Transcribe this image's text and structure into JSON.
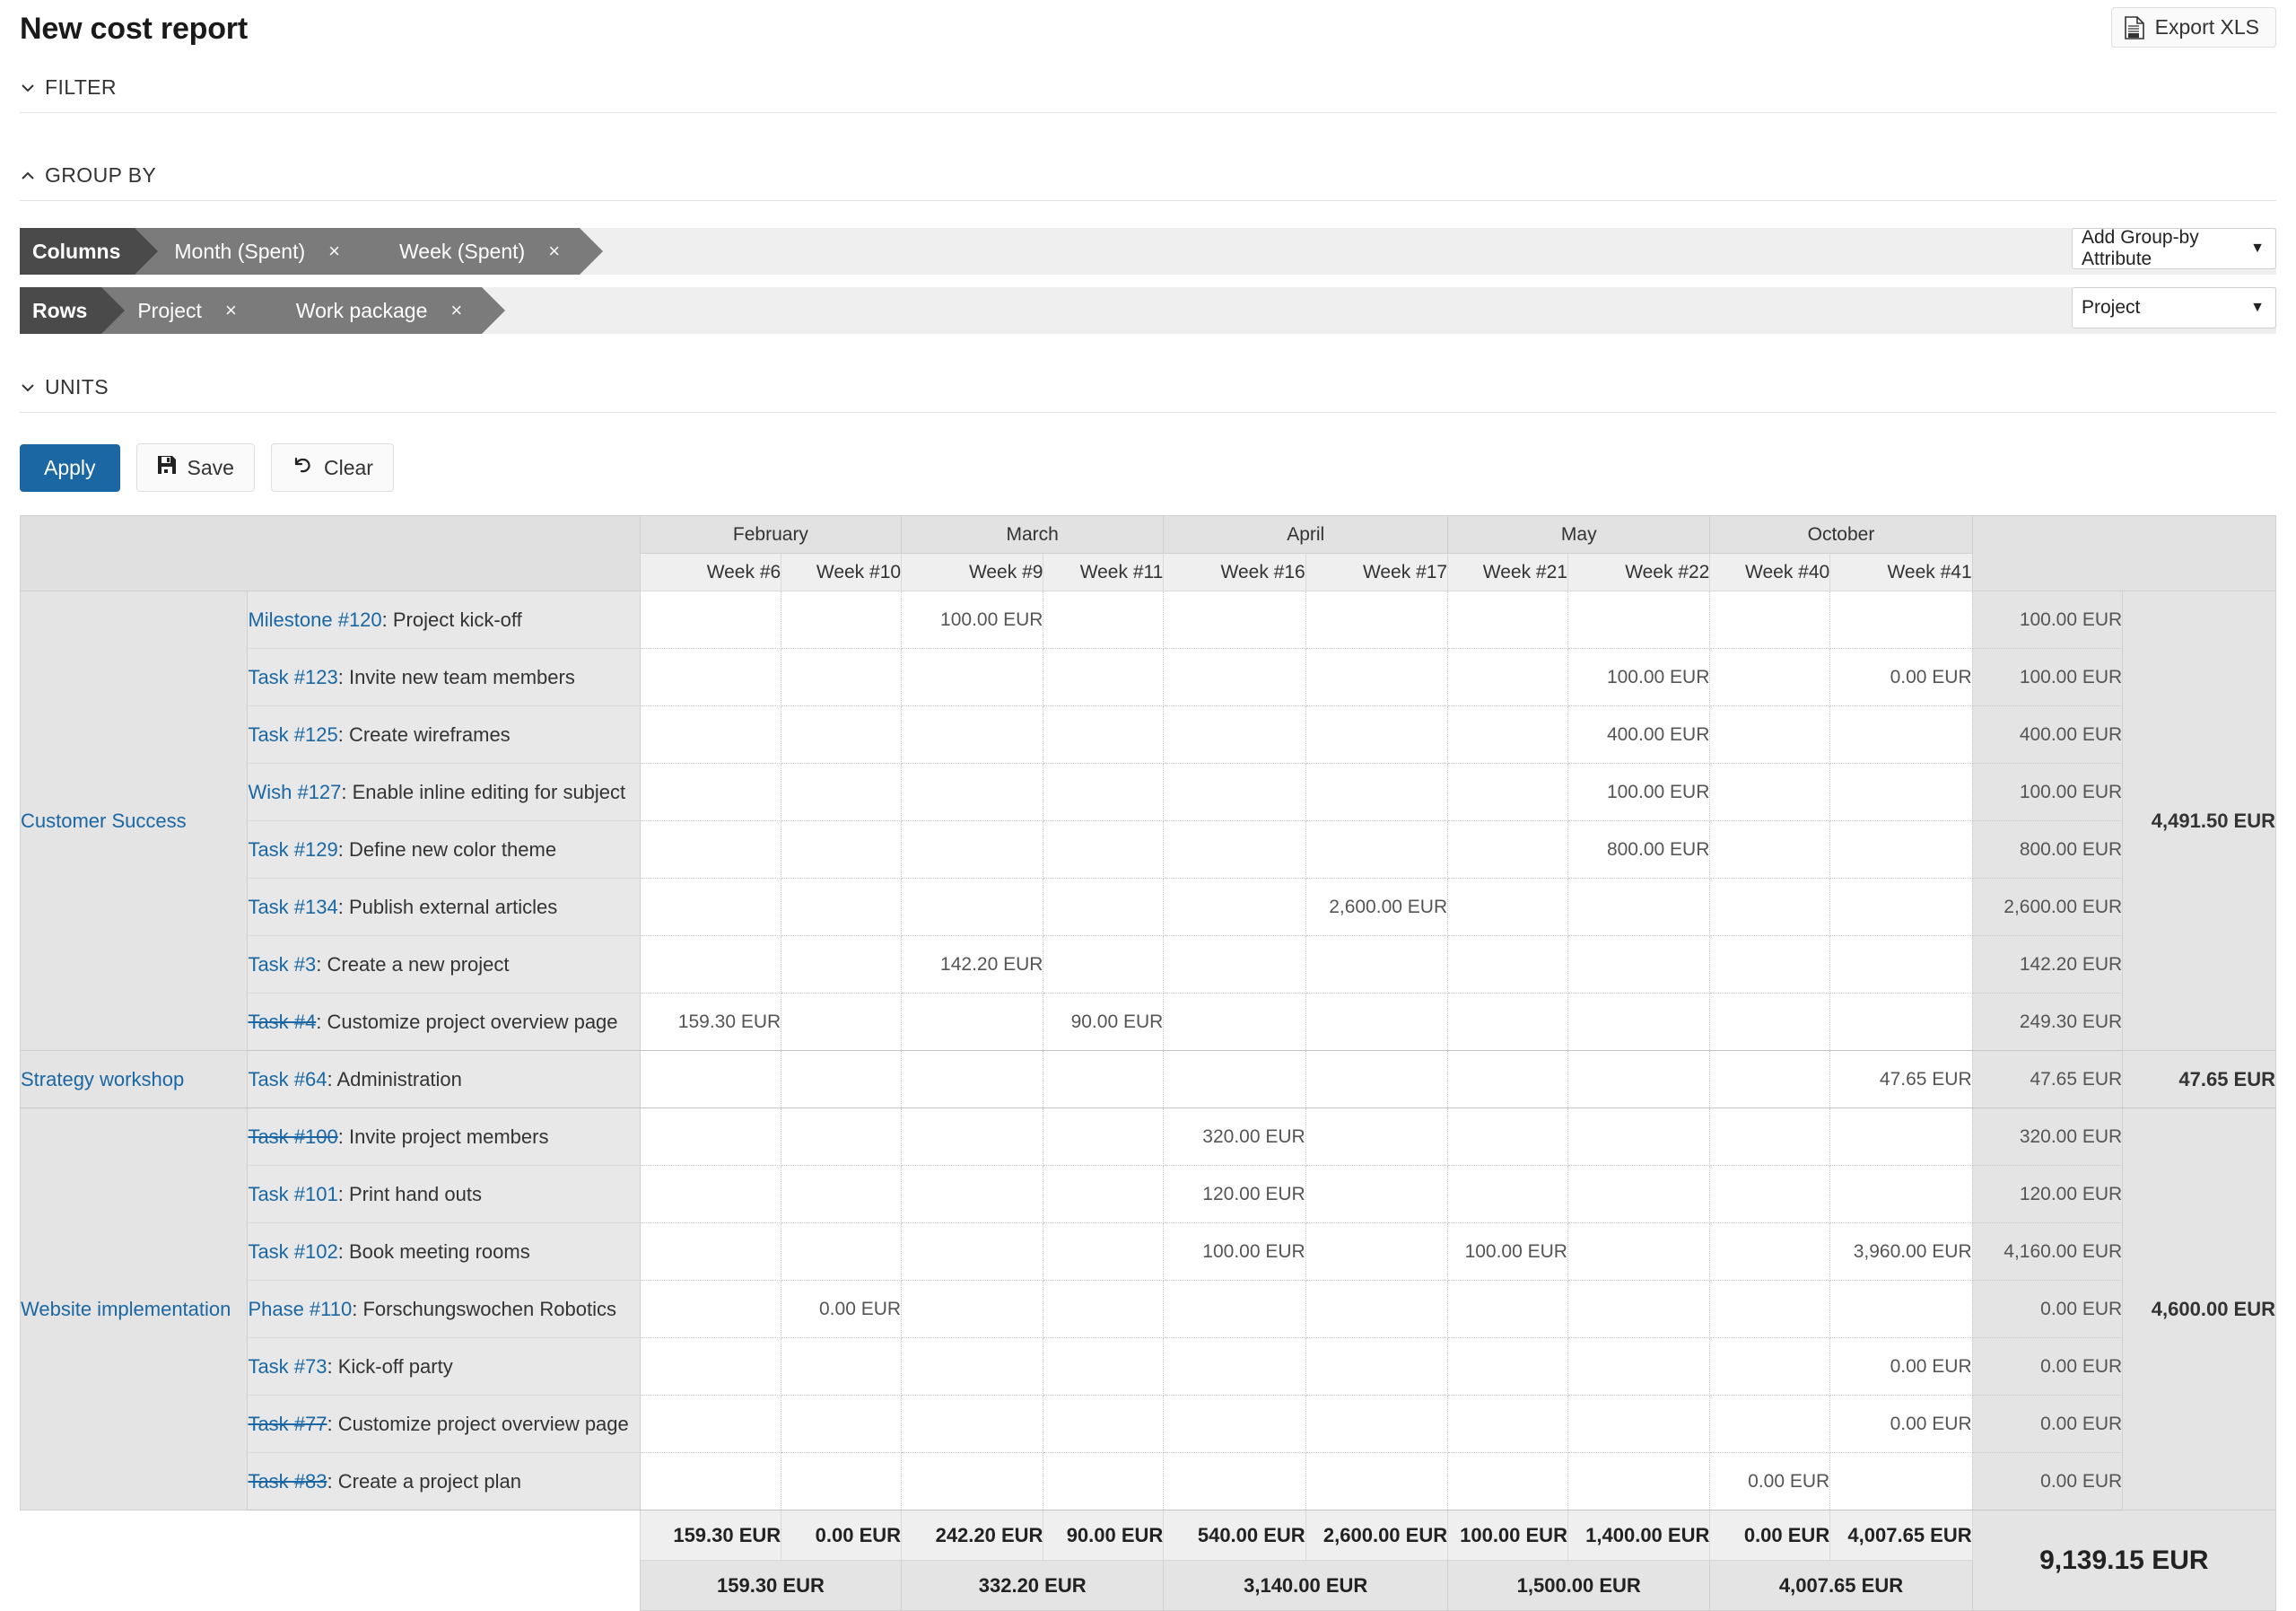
{
  "header": {
    "title": "New cost report",
    "export_label": "Export XLS",
    "export_icon": "xls-file-icon"
  },
  "sections": {
    "filter": {
      "label": "FILTER",
      "state": "collapsed",
      "icon": "chevron-down-icon"
    },
    "group_by": {
      "label": "GROUP BY",
      "state": "expanded",
      "icon": "chevron-up-icon"
    },
    "units": {
      "label": "UNITS",
      "state": "collapsed",
      "icon": "chevron-down-icon"
    }
  },
  "group_by": {
    "columns": {
      "label": "Columns",
      "chips": [
        {
          "label": "Month (Spent)",
          "remove": "×"
        },
        {
          "label": "Week (Spent)",
          "remove": "×"
        }
      ],
      "select_value": "Add Group-by Attribute",
      "caret": "▼"
    },
    "rows": {
      "label": "Rows",
      "chips": [
        {
          "label": "Project",
          "remove": "×"
        },
        {
          "label": "Work package",
          "remove": "×"
        }
      ],
      "select_value": "Project",
      "caret": "▼"
    }
  },
  "actions": {
    "apply": "Apply",
    "save": "Save",
    "save_icon": "floppy-disk-icon",
    "clear": "Clear",
    "clear_icon": "undo-arrow-icon"
  },
  "chart_data": {
    "type": "table",
    "title": "New cost report",
    "currency": "EUR",
    "months": [
      {
        "label": "February",
        "weeks": [
          "Week #6",
          "Week #10"
        ]
      },
      {
        "label": "March",
        "weeks": [
          "Week #9",
          "Week #11"
        ]
      },
      {
        "label": "April",
        "weeks": [
          "Week #16",
          "Week #17"
        ]
      },
      {
        "label": "May",
        "weeks": [
          "Week #21",
          "Week #22"
        ]
      },
      {
        "label": "October",
        "weeks": [
          "Week #40",
          "Week #41"
        ]
      }
    ],
    "week_columns": [
      "Week #6",
      "Week #10",
      "Week #9",
      "Week #11",
      "Week #16",
      "Week #17",
      "Week #21",
      "Week #22",
      "Week #40",
      "Week #41"
    ],
    "projects": [
      {
        "name": "Customer Success",
        "total": "4,491.50 EUR",
        "rows": [
          {
            "link": "Milestone #120",
            "closed": false,
            "subject": ": Project kick-off",
            "cells": [
              "",
              "",
              "100.00 EUR",
              "",
              "",
              "",
              "",
              "",
              "",
              ""
            ],
            "total": "100.00 EUR"
          },
          {
            "link": "Task #123",
            "closed": false,
            "subject": ": Invite new team members",
            "cells": [
              "",
              "",
              "",
              "",
              "",
              "",
              "",
              "100.00 EUR",
              "",
              "0.00 EUR"
            ],
            "total": "100.00 EUR"
          },
          {
            "link": "Task #125",
            "closed": false,
            "subject": ": Create wireframes",
            "cells": [
              "",
              "",
              "",
              "",
              "",
              "",
              "",
              "400.00 EUR",
              "",
              ""
            ],
            "total": "400.00 EUR"
          },
          {
            "link": "Wish #127",
            "closed": false,
            "subject": ": Enable inline editing for subject",
            "cells": [
              "",
              "",
              "",
              "",
              "",
              "",
              "",
              "100.00 EUR",
              "",
              ""
            ],
            "total": "100.00 EUR"
          },
          {
            "link": "Task #129",
            "closed": false,
            "subject": ": Define new color theme",
            "cells": [
              "",
              "",
              "",
              "",
              "",
              "",
              "",
              "800.00 EUR",
              "",
              ""
            ],
            "total": "800.00 EUR"
          },
          {
            "link": "Task #134",
            "closed": false,
            "subject": ": Publish external articles",
            "cells": [
              "",
              "",
              "",
              "",
              "",
              "2,600.00 EUR",
              "",
              "",
              "",
              ""
            ],
            "total": "2,600.00 EUR"
          },
          {
            "link": "Task #3",
            "closed": false,
            "subject": ": Create a new project",
            "cells": [
              "",
              "",
              "142.20 EUR",
              "",
              "",
              "",
              "",
              "",
              "",
              ""
            ],
            "total": "142.20 EUR"
          },
          {
            "link": "Task #4",
            "closed": true,
            "subject": ": Customize project overview page",
            "cells": [
              "159.30 EUR",
              "",
              "",
              "90.00 EUR",
              "",
              "",
              "",
              "",
              "",
              ""
            ],
            "total": "249.30 EUR"
          }
        ]
      },
      {
        "name": "Strategy workshop",
        "total": "47.65 EUR",
        "rows": [
          {
            "link": "Task #64",
            "closed": false,
            "subject": ": Administration",
            "cells": [
              "",
              "",
              "",
              "",
              "",
              "",
              "",
              "",
              "",
              "47.65 EUR"
            ],
            "total": "47.65 EUR"
          }
        ]
      },
      {
        "name": "Website implementation",
        "total": "4,600.00 EUR",
        "rows": [
          {
            "link": "Task #100",
            "closed": true,
            "subject": ": Invite project members",
            "cells": [
              "",
              "",
              "",
              "",
              "320.00 EUR",
              "",
              "",
              "",
              "",
              ""
            ],
            "total": "320.00 EUR"
          },
          {
            "link": "Task #101",
            "closed": false,
            "subject": ": Print hand outs",
            "cells": [
              "",
              "",
              "",
              "",
              "120.00 EUR",
              "",
              "",
              "",
              "",
              ""
            ],
            "total": "120.00 EUR"
          },
          {
            "link": "Task #102",
            "closed": false,
            "subject": ": Book meeting rooms",
            "cells": [
              "",
              "",
              "",
              "",
              "100.00 EUR",
              "",
              "100.00 EUR",
              "",
              "",
              "3,960.00 EUR"
            ],
            "total": "4,160.00 EUR"
          },
          {
            "link": "Phase #110",
            "closed": false,
            "subject": ": Forschungswochen Robotics",
            "cells": [
              "",
              "0.00 EUR",
              "",
              "",
              "",
              "",
              "",
              "",
              "",
              ""
            ],
            "total": "0.00 EUR"
          },
          {
            "link": "Task #73",
            "closed": false,
            "subject": ": Kick-off party",
            "cells": [
              "",
              "",
              "",
              "",
              "",
              "",
              "",
              "",
              "",
              "0.00 EUR"
            ],
            "total": "0.00 EUR"
          },
          {
            "link": "Task #77",
            "closed": true,
            "subject": ": Customize project overview page",
            "cells": [
              "",
              "",
              "",
              "",
              "",
              "",
              "",
              "",
              "",
              "0.00 EUR"
            ],
            "total": "0.00 EUR"
          },
          {
            "link": "Task #83",
            "closed": true,
            "subject": ": Create a project plan",
            "cells": [
              "",
              "",
              "",
              "",
              "",
              "",
              "",
              "",
              "0.00 EUR",
              ""
            ],
            "total": "0.00 EUR"
          }
        ]
      }
    ],
    "week_totals": [
      "159.30 EUR",
      "0.00 EUR",
      "242.20 EUR",
      "90.00 EUR",
      "540.00 EUR",
      "2,600.00 EUR",
      "100.00 EUR",
      "1,400.00 EUR",
      "0.00 EUR",
      "4,007.65 EUR"
    ],
    "month_totals": [
      "159.30 EUR",
      "332.20 EUR",
      "3,140.00 EUR",
      "1,500.00 EUR",
      "4,007.65 EUR"
    ],
    "grand_total": "9,139.15 EUR"
  },
  "colors": {
    "primary": "#1a67a3",
    "link": "#1a67a3",
    "chip_label_bg": "#4a4a4a",
    "chip_bg": "#7b7b7b",
    "header_bg": "#e2e2e2"
  }
}
